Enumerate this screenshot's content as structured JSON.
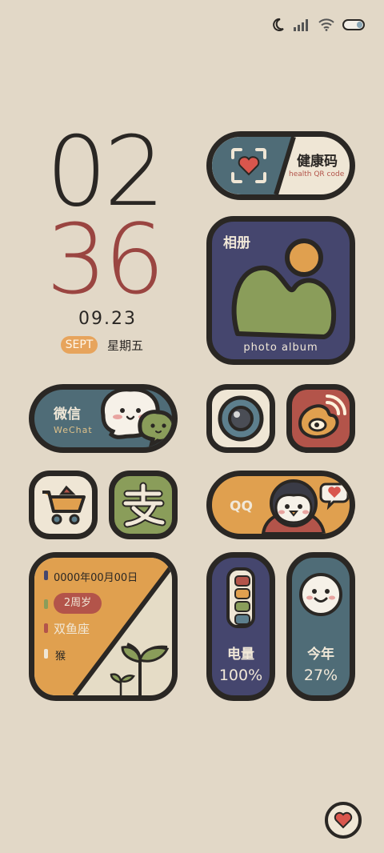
{
  "clock": {
    "hour": "02",
    "minute": "36",
    "date": "09.23",
    "month": "SEPT",
    "weekday": "星期五"
  },
  "health": {
    "title": "健康码",
    "subtitle": "health QR code"
  },
  "album": {
    "title": "相册",
    "subtitle": "photo album"
  },
  "wechat": {
    "title": "微信",
    "subtitle": "WeChat"
  },
  "qq": {
    "title": "QQ"
  },
  "info": {
    "date": "0000年00月00日",
    "age": "2周岁",
    "zodiac": "双鱼座",
    "animal": "猴"
  },
  "battery": {
    "label": "电量",
    "value": "100%"
  },
  "year": {
    "label": "今年",
    "value": "27%"
  },
  "colors": {
    "background": "#e2d8c7",
    "teal": "#4f6c77",
    "navy": "#45466e",
    "orange": "#e0a04f",
    "red": "#b3544a",
    "green": "#8a9d5a",
    "dark": "#2a2724"
  }
}
